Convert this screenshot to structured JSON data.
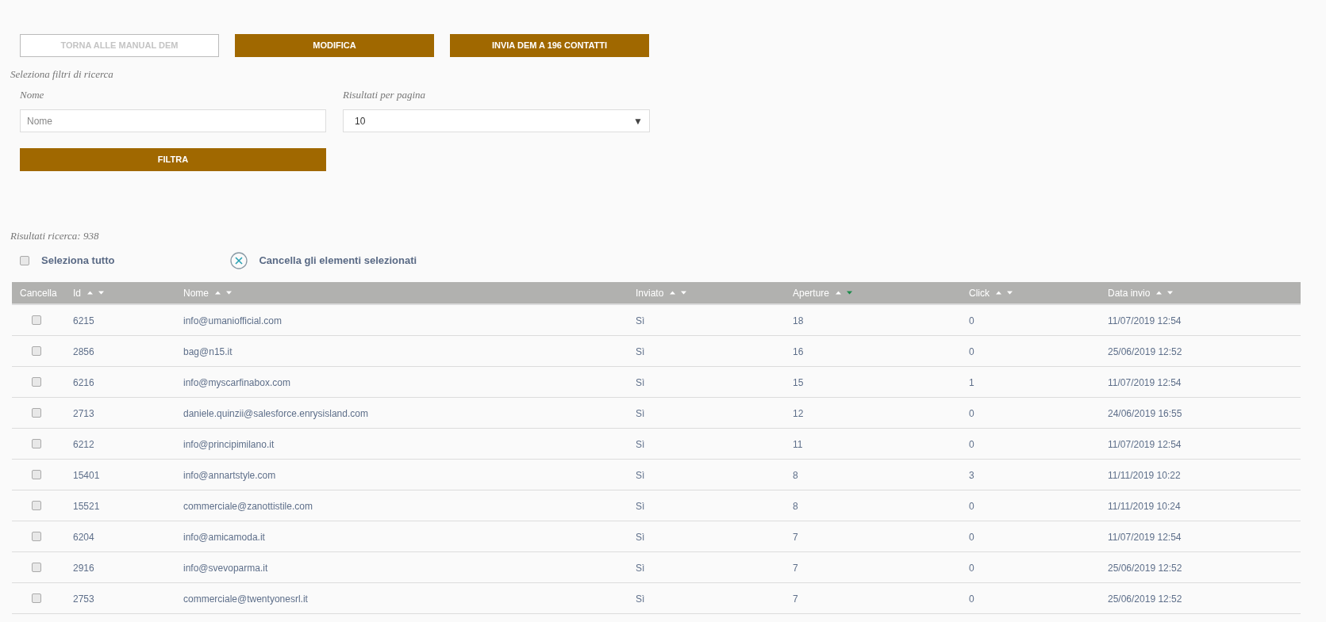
{
  "actions": [
    {
      "label": "TORNA ALLE MANUAL DEM",
      "kind": "outline"
    },
    {
      "label": "MODIFICA",
      "kind": "primary"
    },
    {
      "label": "INVIA DEM A 196 CONTATTI",
      "kind": "primary"
    }
  ],
  "filters": {
    "title": "Seleziona filtri di ricerca",
    "name_field": {
      "label": "Nome",
      "placeholder": "Nome"
    },
    "per_page": {
      "label": "Risultati per pagina",
      "value": "10",
      "arrow": "▼"
    },
    "submit": "FILTRA"
  },
  "results_count": "Risultati ricerca: 938",
  "select_all": {
    "label": "Seleziona tutto",
    "checked": false
  },
  "delete_selected": "Cancella gli elementi selezionati",
  "table": {
    "columns": [
      {
        "label": "Cancella",
        "kind": "checkbox"
      },
      {
        "label": "Id",
        "kind": "sortable",
        "sorted": false
      },
      {
        "label": "Nome",
        "kind": "sortable",
        "sorted": false
      },
      {
        "label": "Inviato",
        "kind": "sortable",
        "sorted": false
      },
      {
        "label": "Aperture",
        "kind": "sortable",
        "sorted": true
      },
      {
        "label": "Click",
        "kind": "sortable",
        "sorted": false
      },
      {
        "label": "Data invio",
        "kind": "sortable",
        "sorted": false
      }
    ],
    "rows": [
      {
        "checked": false,
        "cells": [
          "",
          "6215",
          "info@umaniofficial.com",
          "Sì",
          "18",
          "0",
          "11/07/2019 12:54"
        ]
      },
      {
        "checked": false,
        "cells": [
          "",
          "2856",
          "bag@n15.it",
          "Sì",
          "16",
          "0",
          "25/06/2019 12:52"
        ]
      },
      {
        "checked": false,
        "cells": [
          "",
          "6216",
          "info@myscarfinabox.com",
          "Sì",
          "15",
          "1",
          "11/07/2019 12:54"
        ]
      },
      {
        "checked": false,
        "cells": [
          "",
          "2713",
          "daniele.quinzii@salesforce.enrysisland.com",
          "Sì",
          "12",
          "0",
          "24/06/2019 16:55"
        ]
      },
      {
        "checked": false,
        "cells": [
          "",
          "6212",
          "info@principimilano.it",
          "Sì",
          "11",
          "0",
          "11/07/2019 12:54"
        ]
      },
      {
        "checked": false,
        "cells": [
          "",
          "15401",
          "info@annartstyle.com",
          "Sì",
          "8",
          "3",
          "11/11/2019 10:22"
        ]
      },
      {
        "checked": false,
        "cells": [
          "",
          "15521",
          "commerciale@zanottistile.com",
          "Sì",
          "8",
          "0",
          "11/11/2019 10:24"
        ]
      },
      {
        "checked": false,
        "cells": [
          "",
          "6204",
          "info@amicamoda.it",
          "Sì",
          "7",
          "0",
          "11/07/2019 12:54"
        ]
      },
      {
        "checked": false,
        "cells": [
          "",
          "2916",
          "info@svevoparma.it",
          "Sì",
          "7",
          "0",
          "25/06/2019 12:52"
        ]
      },
      {
        "checked": false,
        "cells": [
          "",
          "2753",
          "commerciale@twentyonesrl.it",
          "Sì",
          "7",
          "0",
          "25/06/2019 12:52"
        ]
      }
    ]
  }
}
